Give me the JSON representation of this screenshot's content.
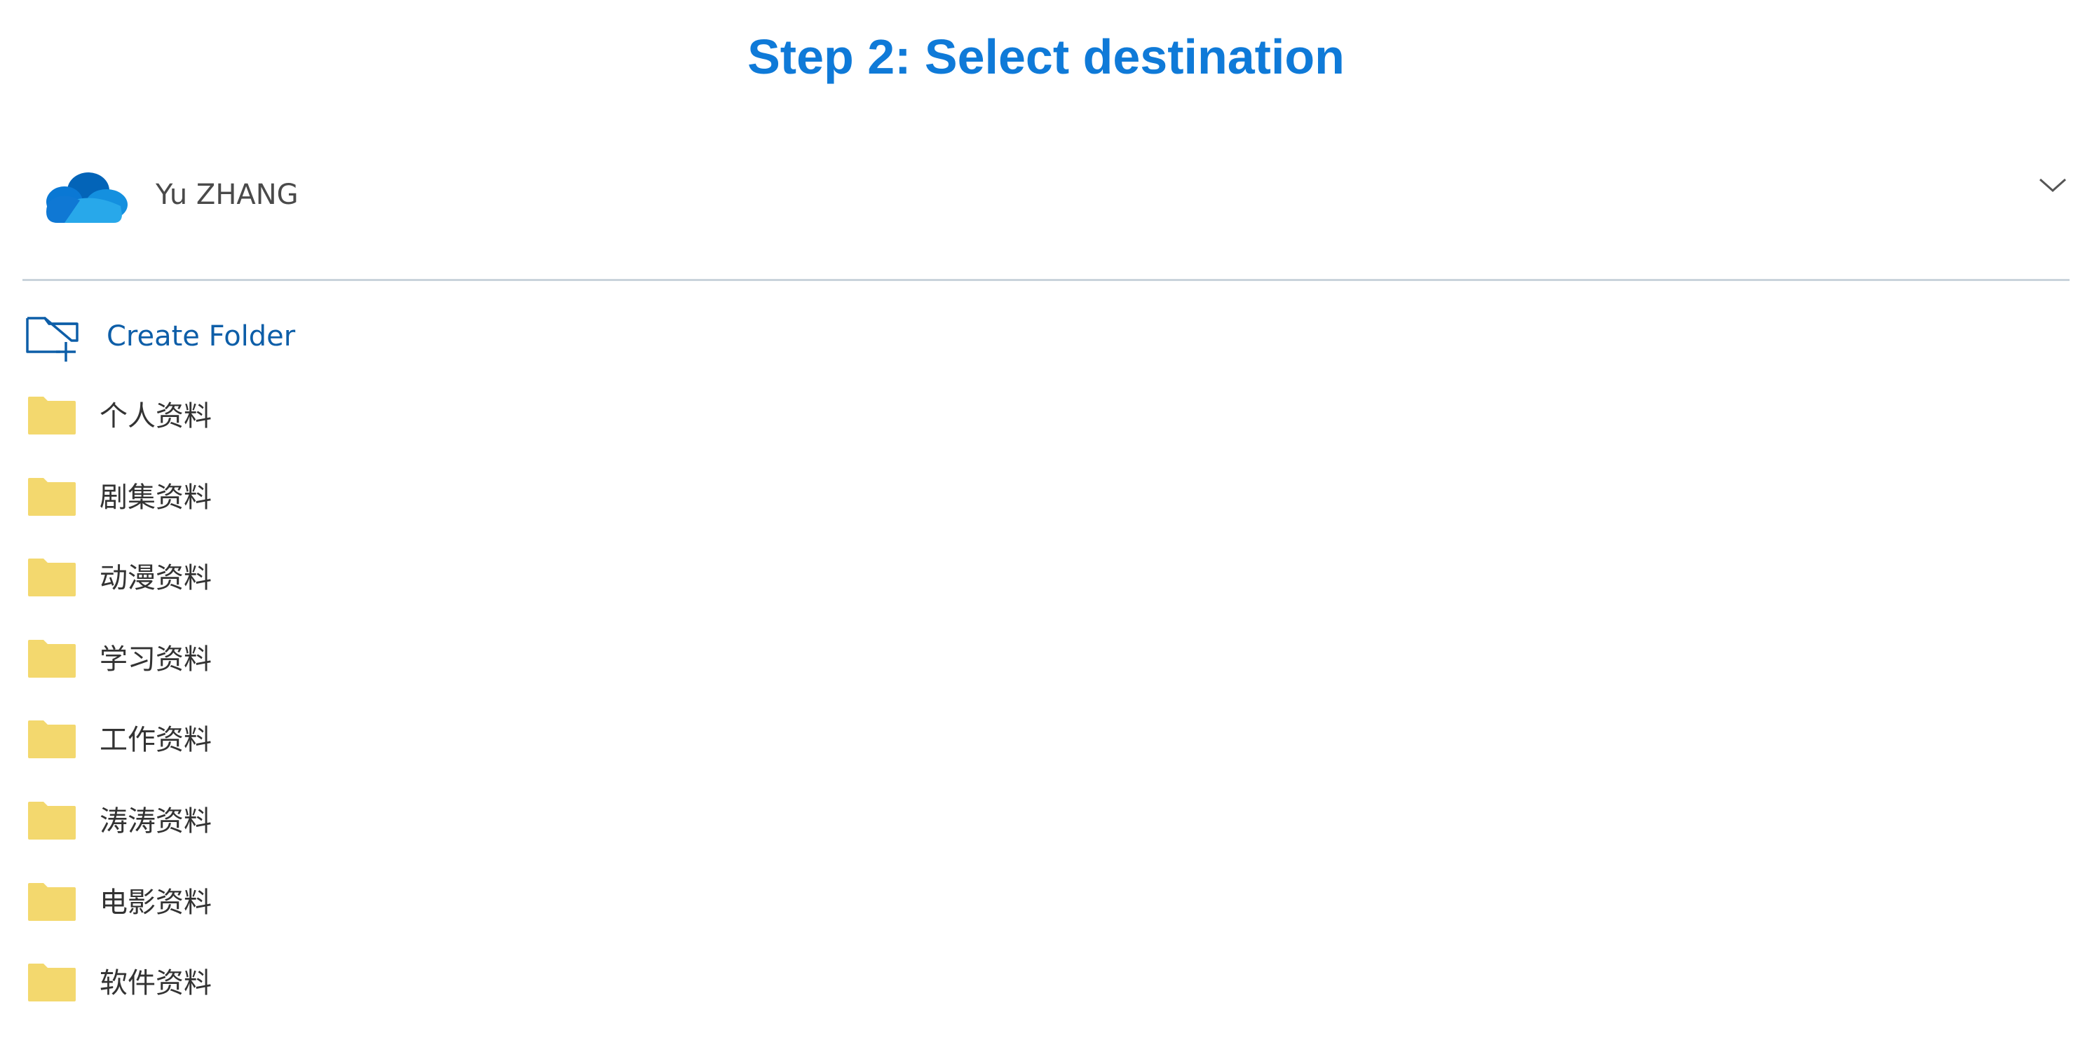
{
  "title": "Step 2: Select destination",
  "account": {
    "name": "Yu ZHANG",
    "icon": "onedrive-cloud-icon",
    "expand_icon": "chevron-down-icon"
  },
  "create_folder": {
    "label": "Create Folder",
    "icon": "folder-add-icon"
  },
  "folders": [
    {
      "name": "个人资料"
    },
    {
      "name": "剧集资料"
    },
    {
      "name": "动漫资料"
    },
    {
      "name": "学习资料"
    },
    {
      "name": "工作资料"
    },
    {
      "name": "涛涛资料"
    },
    {
      "name": "电影资料"
    },
    {
      "name": "软件资料"
    }
  ],
  "colors": {
    "title": "#0f7ad8",
    "link": "#0d5ea8",
    "folder": "#f3d86e",
    "divider": "#c9d3db"
  }
}
